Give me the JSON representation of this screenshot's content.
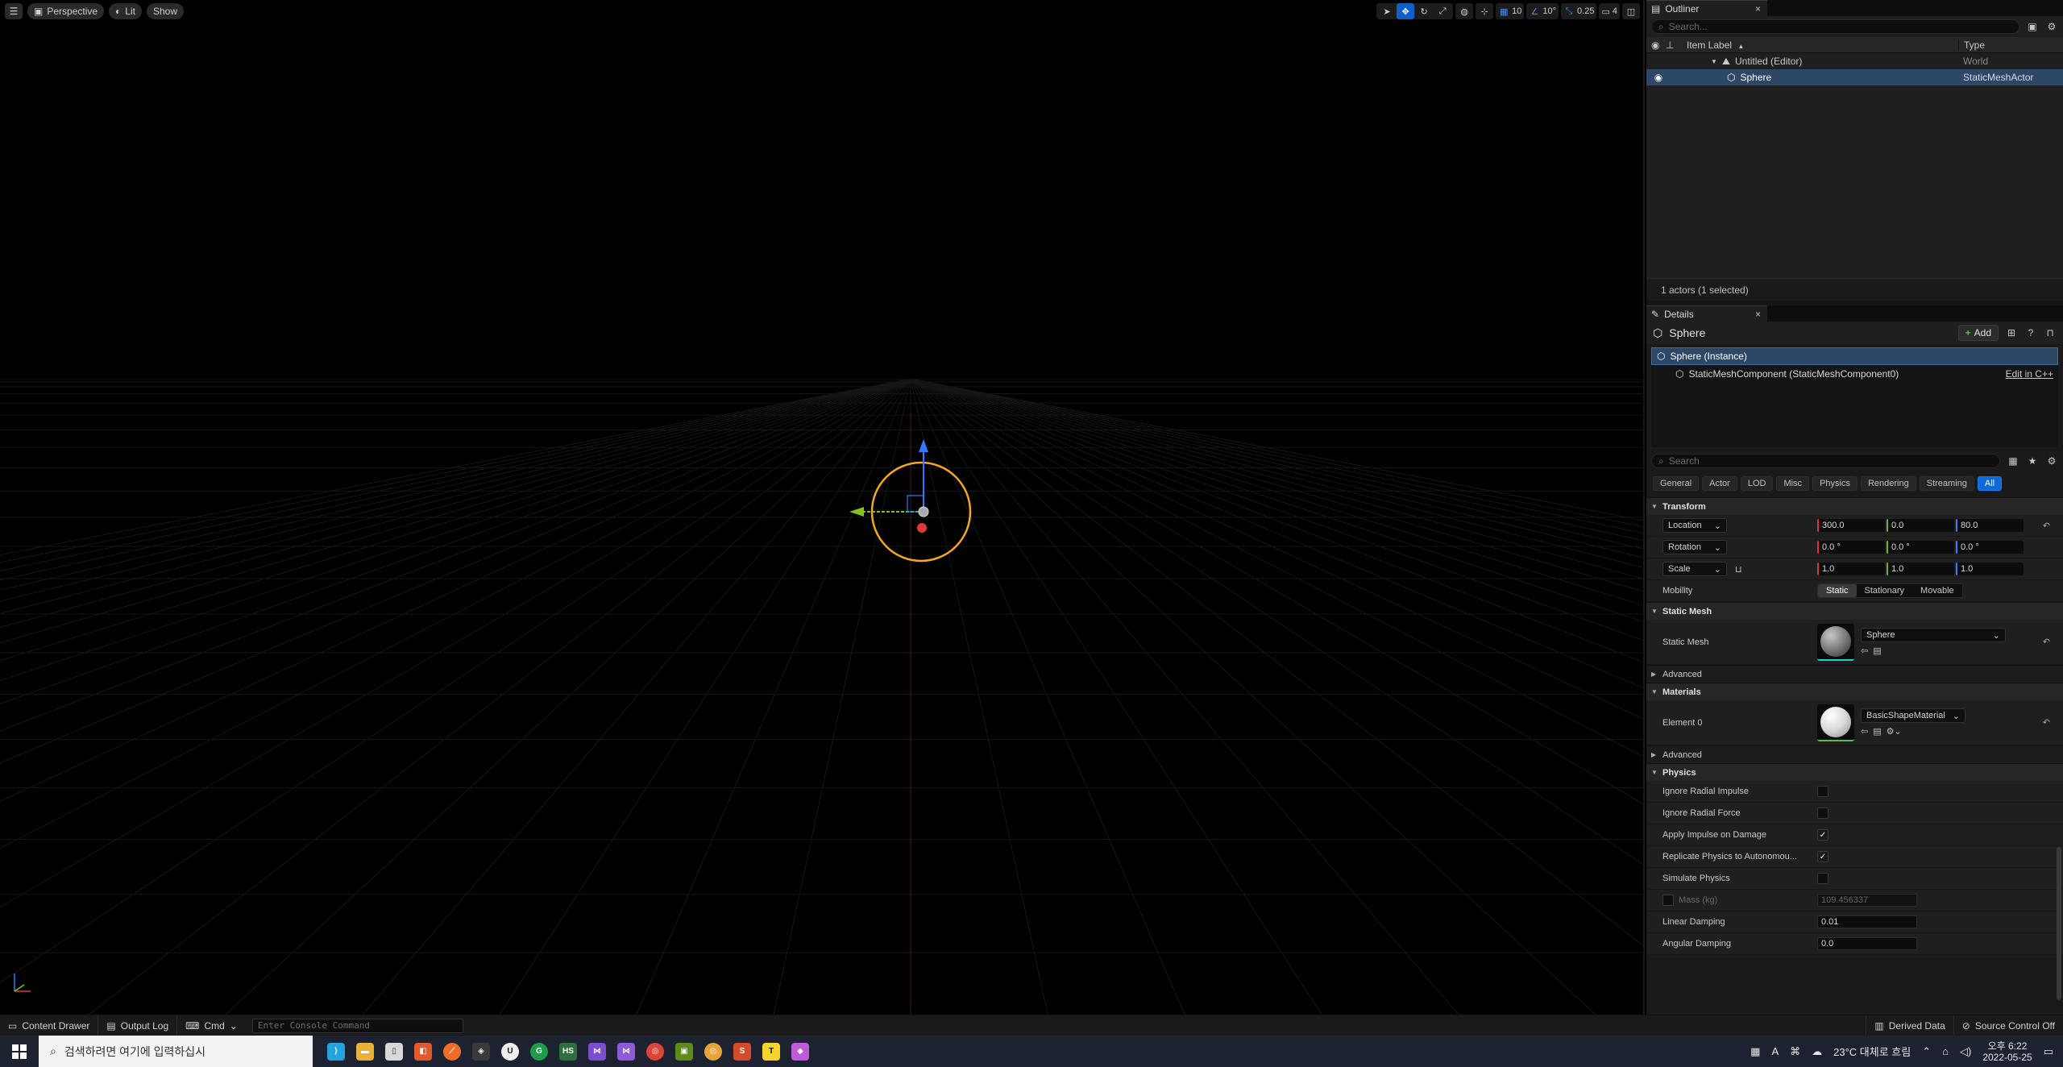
{
  "viewport": {
    "toolbar_left": {
      "menu_icon": "hamburger-icon",
      "perspective_label": "Perspective",
      "lit_label": "Lit",
      "show_label": "Show"
    },
    "toolbar_right": {
      "grid_snap_value": "10",
      "rotation_snap_value": "10°",
      "scale_snap_value": "0.25",
      "camera_speed_value": "4"
    }
  },
  "outliner": {
    "tab_label": "Outliner",
    "close_label": "×",
    "search_placeholder": "Search...",
    "col_label": "Item Label",
    "col_sort_arrow": "▲",
    "col_type": "Type",
    "rows": [
      {
        "label": "Untitled (Editor)",
        "type": "World"
      },
      {
        "label": "Sphere",
        "type": "StaticMeshActor"
      }
    ],
    "status": "1 actors (1 selected)"
  },
  "details": {
    "tab_label": "Details",
    "close_label": "×",
    "actor_name": "Sphere",
    "add_label": "Add",
    "components": [
      {
        "label": "Sphere (Instance)"
      },
      {
        "label": "StaticMeshComponent (StaticMeshComponent0)",
        "link": "Edit in C++"
      }
    ],
    "search_placeholder": "Search",
    "filter_tabs": [
      "General",
      "Actor",
      "LOD",
      "Misc",
      "Physics",
      "Rendering",
      "Streaming",
      "All"
    ],
    "active_filter": "All",
    "transform": {
      "title": "Transform",
      "location": {
        "label": "Location",
        "x": "300.0",
        "y": "0.0",
        "z": "80.0"
      },
      "rotation": {
        "label": "Rotation",
        "x": "0.0 °",
        "y": "0.0 °",
        "z": "0.0 °"
      },
      "scale": {
        "label": "Scale",
        "x": "1.0",
        "y": "1.0",
        "z": "1.0"
      },
      "mobility": {
        "label": "Mobility",
        "options": [
          "Static",
          "Stationary",
          "Movable"
        ],
        "selected": "Static"
      }
    },
    "static_mesh": {
      "title": "Static Mesh",
      "prop_label": "Static Mesh",
      "value": "Sphere",
      "advanced": "Advanced"
    },
    "materials": {
      "title": "Materials",
      "prop_label": "Element 0",
      "value": "BasicShapeMaterial",
      "advanced": "Advanced"
    },
    "physics": {
      "title": "Physics",
      "props": [
        {
          "label": "Ignore Radial Impulse",
          "checked": false
        },
        {
          "label": "Ignore Radial Force",
          "checked": false
        },
        {
          "label": "Apply Impulse on Damage",
          "checked": true
        },
        {
          "label": "Replicate Physics to Autonomou...",
          "checked": true
        },
        {
          "label": "Simulate Physics",
          "checked": false
        }
      ],
      "mass_label": "Mass (kg)",
      "mass_value": "109.456337",
      "linear_damping_label": "Linear Damping",
      "linear_damping_value": "0.01",
      "angular_damping_label": "Angular Damping",
      "angular_damping_value": "0.0"
    }
  },
  "bottombar": {
    "content_drawer": "Content Drawer",
    "output_log": "Output Log",
    "cmd": "Cmd",
    "console_placeholder": "Enter Console Command",
    "derived_data": "Derived Data",
    "source_control": "Source Control Off"
  },
  "taskbar": {
    "search_placeholder": "검색하려면 여기에 입력하십시",
    "weather": "23°C 대체로 흐림",
    "time": "오후 6:22",
    "date": "2022-05-25"
  },
  "colors": {
    "accent_blue": "#0f6ad8",
    "selection": "#2d4766",
    "gizmo_orange": "#f5a623",
    "gizmo_x": "#e03b2f",
    "gizmo_y": "#7fc31c",
    "gizmo_z": "#2f7bff"
  }
}
